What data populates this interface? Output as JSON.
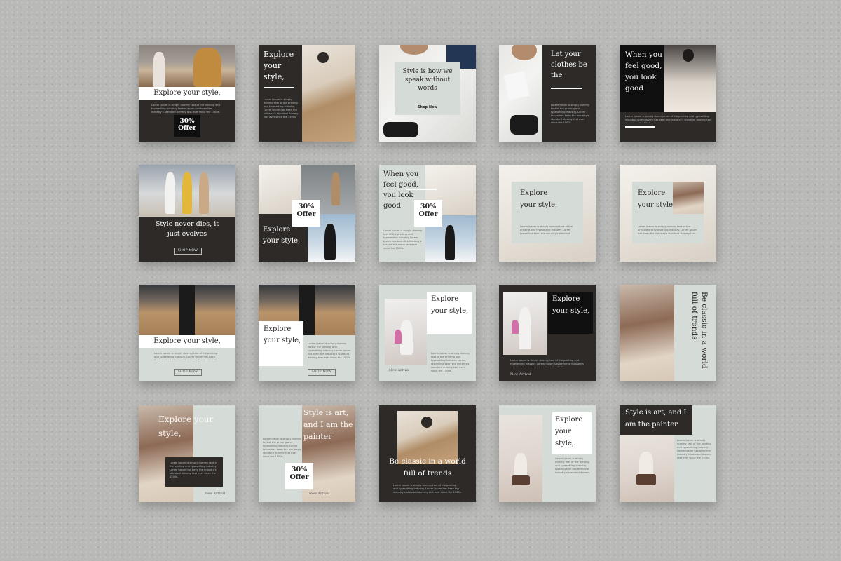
{
  "lorem": "Lorem Ipsum is simply dummy text of the printing and typesetting industry. Lorem Ipsum has been the industry's standard dummy text ever since the 1500s.",
  "cards": {
    "c1": {
      "headline": "Explore your style,",
      "offer_a": "30%",
      "offer_b": "Offer"
    },
    "c2": {
      "headline": "Explore your style,"
    },
    "c3": {
      "headline": "Style is how we speak without words",
      "cta": "Shop Now"
    },
    "c4": {
      "headline": "Let your clothes be the"
    },
    "c5": {
      "headline": "When you feel good, you look good"
    },
    "c6": {
      "headline": "Style never dies, it just evolves",
      "cta": "SHOP NOW"
    },
    "c7": {
      "headline": "Explore your style,",
      "offer_a": "30%",
      "offer_b": "Offer"
    },
    "c8": {
      "headline": "When you feel good, you look good",
      "offer_a": "30%",
      "offer_b": "Offer"
    },
    "c9": {
      "headline": "Explore your style,"
    },
    "c10": {
      "headline": "Explore your style,"
    },
    "c11": {
      "headline": "Explore your style,",
      "cta": "SHOP NOW"
    },
    "c12": {
      "headline": "Explore your style,",
      "cta": "SHOP NOW"
    },
    "c13": {
      "headline": "Explore your style,",
      "tag": "New Arrival"
    },
    "c14": {
      "headline": "Explore your style,",
      "tag": "New Arrival"
    },
    "c15": {
      "headline": "Be classic in a world full of trends"
    },
    "c16": {
      "headline": "Explore your style,",
      "tag": "New Arrival"
    },
    "c17": {
      "headline": "Style is art, and I am the painter",
      "offer_a": "30%",
      "offer_b": "Offer",
      "tag": "New Arrival"
    },
    "c18": {
      "headline": "Be classic in a world full of trends"
    },
    "c19": {
      "headline": "Explore your style,"
    },
    "c20": {
      "headline": "Style is art, and I am the painter"
    }
  }
}
